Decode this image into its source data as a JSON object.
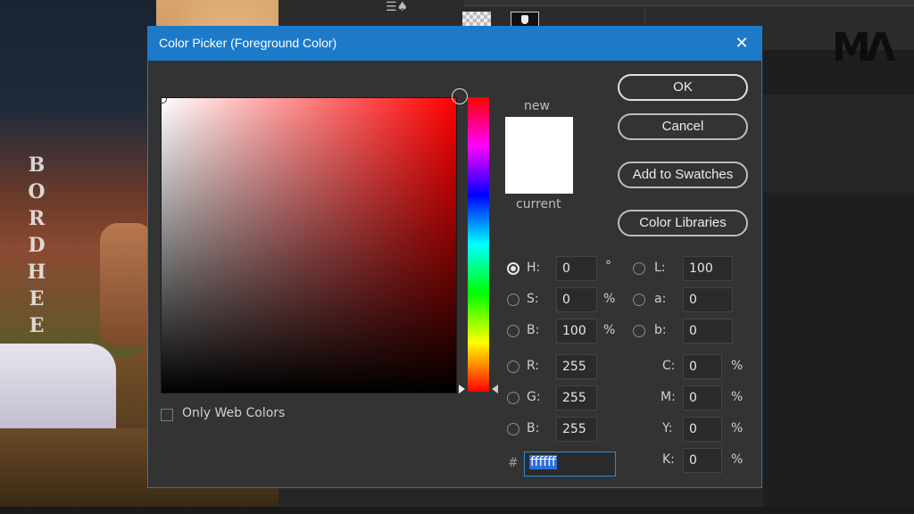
{
  "background": {
    "photo_print": "BORDHEE"
  },
  "dialog": {
    "title": "Color Picker (Foreground Color)",
    "close_glyph": "✕",
    "swatch_new_label": "new",
    "swatch_current_label": "current",
    "new_color": "#ffffff",
    "current_color": "#ffffff",
    "buttons": {
      "ok": "OK",
      "cancel": "Cancel",
      "add_to_swatches": "Add to Swatches",
      "color_libraries": "Color Libraries"
    },
    "only_web_colors_label": "Only Web Colors",
    "only_web_colors_checked": false,
    "hsb": {
      "h_label": "H:",
      "h_value": "0",
      "h_unit": "°",
      "s_label": "S:",
      "s_value": "0",
      "s_unit": "%",
      "b_label": "B:",
      "b_value": "100",
      "b_unit": "%",
      "selected": "H"
    },
    "lab": {
      "l_label": "L:",
      "l_value": "100",
      "a_label": "a:",
      "a_value": "0",
      "b_label": "b:",
      "b_value": "0"
    },
    "rgb": {
      "r_label": "R:",
      "r_value": "255",
      "g_label": "G:",
      "g_value": "255",
      "b_label": "B:",
      "b_value": "255"
    },
    "cmyk": {
      "c_label": "C:",
      "c_value": "0",
      "c_unit": "%",
      "m_label": "M:",
      "m_value": "0",
      "m_unit": "%",
      "y_label": "Y:",
      "y_value": "0",
      "y_unit": "%",
      "k_label": "K:",
      "k_value": "0",
      "k_unit": "%"
    },
    "hex_label": "#",
    "hex_value": "ffffff"
  },
  "colors": {
    "titlebar": "#1c7ac9",
    "dialog_bg": "#333333",
    "hue_selected": "#ff0000"
  }
}
